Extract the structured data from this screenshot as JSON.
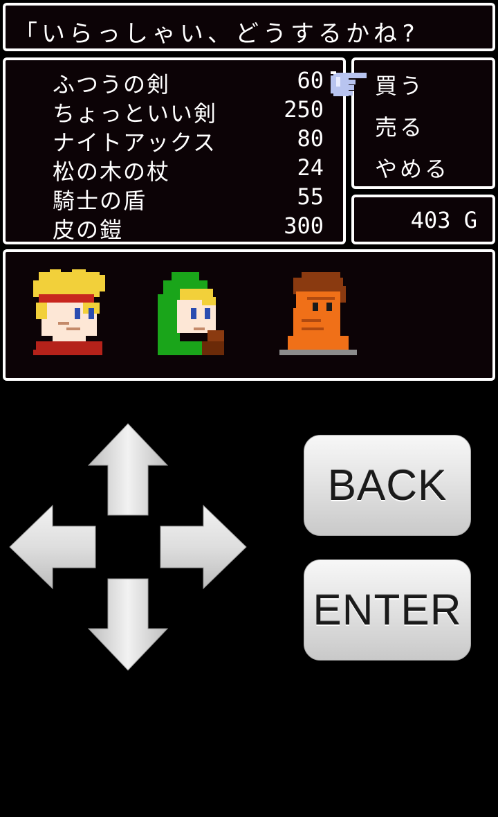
{
  "dialog": {
    "text": "「いらっしゃい、どうするかね?"
  },
  "shop_items": [
    {
      "name": "ふつうの剣",
      "price": "60"
    },
    {
      "name": "ちょっといい剣",
      "price": "250"
    },
    {
      "name": "ナイトアックス",
      "price": "80"
    },
    {
      "name": "松の木の杖",
      "price": "24"
    },
    {
      "name": "騎士の盾",
      "price": "55"
    },
    {
      "name": "皮の鎧",
      "price": "300"
    }
  ],
  "menu": {
    "selected_index": 0,
    "items": [
      "買う",
      "売る",
      "やめる"
    ]
  },
  "gold": {
    "text": "403 G"
  },
  "party": [
    {
      "icon": "blond-warrior-portrait"
    },
    {
      "icon": "green-hood-elf-portrait"
    },
    {
      "icon": "orange-brute-portrait"
    }
  ],
  "controls": {
    "back_label": "BACK",
    "enter_label": "ENTER"
  },
  "colors": {
    "window_bg": "#0c0306",
    "window_border": "#ffffff",
    "cursor_hand": "#b8c4f0"
  }
}
